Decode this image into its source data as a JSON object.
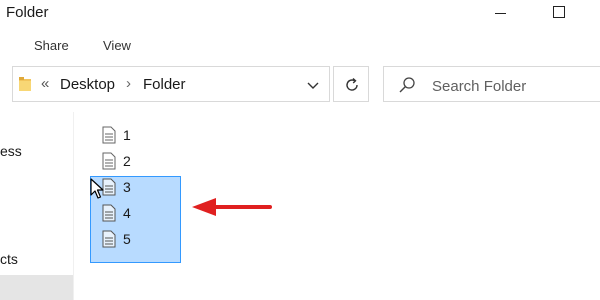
{
  "window": {
    "title": "Folder"
  },
  "ribbon": {
    "tabs": [
      {
        "label": "Share"
      },
      {
        "label": "View"
      }
    ]
  },
  "address": {
    "overflow_label": "«",
    "crumbs": [
      {
        "label": "Desktop"
      },
      {
        "label": "Folder"
      }
    ],
    "separator": "›"
  },
  "search": {
    "placeholder": "Search Folder"
  },
  "nav": {
    "items": [
      {
        "label": "ess"
      },
      {
        "label": "cts"
      }
    ]
  },
  "files": [
    {
      "name": "1",
      "selected": false
    },
    {
      "name": "2",
      "selected": false
    },
    {
      "name": "3",
      "selected": true
    },
    {
      "name": "4",
      "selected": true
    },
    {
      "name": "5",
      "selected": true
    }
  ],
  "colors": {
    "selection": "#3399ff",
    "arrow": "#e02020"
  },
  "icons": [
    "folder-icon",
    "chevron-down-icon",
    "refresh-icon",
    "search-icon",
    "document-icon",
    "mouse-cursor-icon",
    "arrow-left-icon"
  ]
}
